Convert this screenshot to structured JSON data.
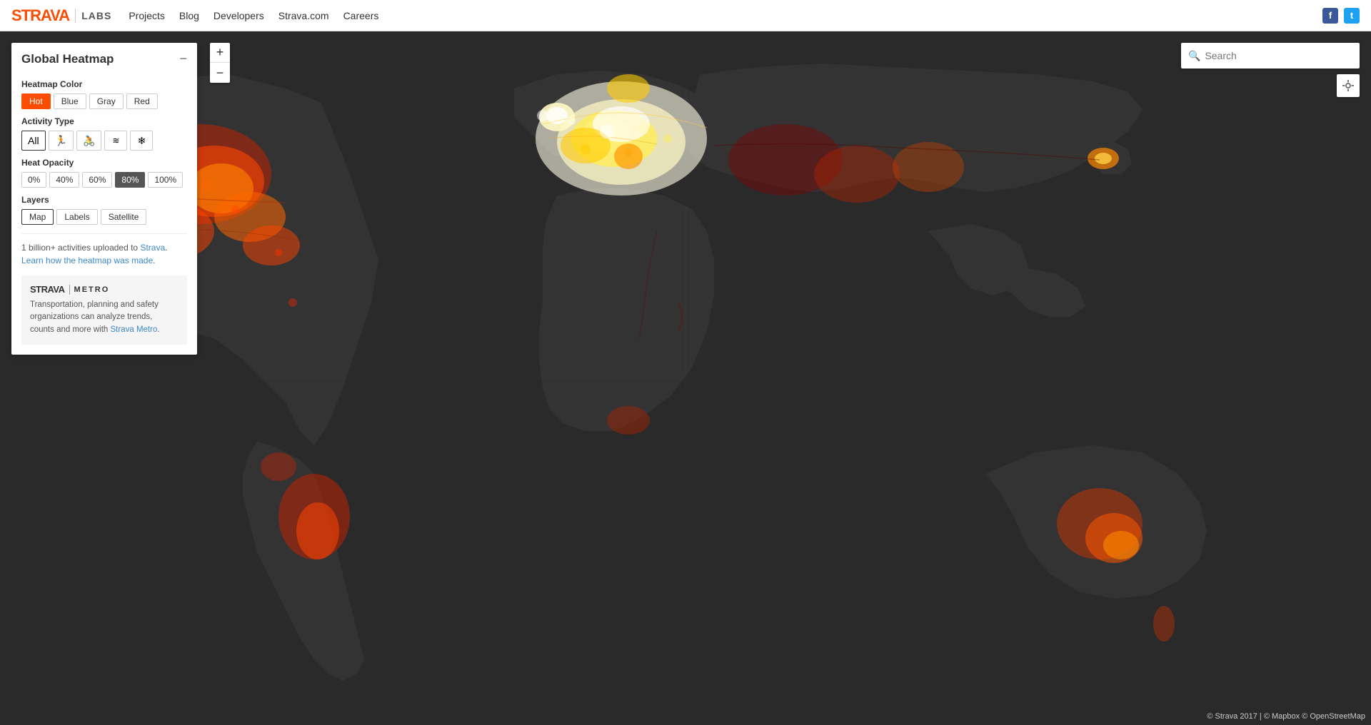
{
  "navbar": {
    "brand": {
      "strava": "STRAVA",
      "divider": "|",
      "labs": "LABS"
    },
    "nav_links": [
      {
        "label": "Projects",
        "href": "#"
      },
      {
        "label": "Blog",
        "href": "#"
      },
      {
        "label": "Developers",
        "href": "#"
      },
      {
        "label": "Strava.com",
        "href": "#"
      },
      {
        "label": "Careers",
        "href": "#"
      }
    ],
    "social": {
      "facebook": "f",
      "twitter": "t"
    }
  },
  "panel": {
    "title": "Global Heatmap",
    "collapse_icon": "−",
    "heatmap_color": {
      "label": "Heatmap Color",
      "options": [
        {
          "label": "Hot",
          "active": true
        },
        {
          "label": "Blue",
          "active": false
        },
        {
          "label": "Gray",
          "active": false
        },
        {
          "label": "Red",
          "active": false
        }
      ]
    },
    "activity_type": {
      "label": "Activity Type",
      "options": [
        {
          "label": "All",
          "icon": "All",
          "active": true
        },
        {
          "label": "Run",
          "icon": "🏃",
          "active": false
        },
        {
          "label": "Ride",
          "icon": "🚴",
          "active": false
        },
        {
          "label": "Water",
          "icon": "〜",
          "active": false
        },
        {
          "label": "Winter",
          "icon": "❄",
          "active": false
        }
      ]
    },
    "heat_opacity": {
      "label": "Heat Opacity",
      "options": [
        {
          "label": "0%",
          "active": false
        },
        {
          "label": "40%",
          "active": false
        },
        {
          "label": "60%",
          "active": false
        },
        {
          "label": "80%",
          "active": true
        },
        {
          "label": "100%",
          "active": false
        }
      ]
    },
    "layers": {
      "label": "Layers",
      "options": [
        {
          "label": "Map",
          "active": true
        },
        {
          "label": "Labels",
          "active": false
        },
        {
          "label": "Satellite",
          "active": false
        }
      ]
    },
    "info": {
      "text_before": "1 billion+ activities uploaded to ",
      "strava_link": "Strava",
      "text_after": ".",
      "learn_text": "Learn how the heatmap was made",
      "learn_link": "."
    },
    "metro": {
      "strava": "STRAVA",
      "divider": "|",
      "metro": "METRO",
      "description_before": "Transportation, planning and safety organizations can analyze trends, counts and more with ",
      "link_text": "Strava Metro",
      "description_after": "."
    }
  },
  "zoom": {
    "plus": "+",
    "minus": "−"
  },
  "search": {
    "placeholder": "Search",
    "icon": "🔍"
  },
  "copyright": {
    "text": "© Strava 2017 | © Mapbox © OpenStreetMap"
  }
}
